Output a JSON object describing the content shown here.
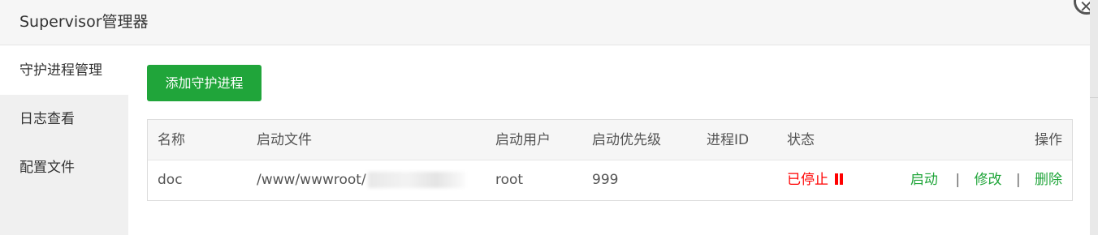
{
  "window": {
    "title": "Supervisor管理器",
    "close_icon": "close-icon"
  },
  "sidebar": {
    "items": [
      {
        "label": "守护进程管理",
        "active": true
      },
      {
        "label": "日志查看",
        "active": false
      },
      {
        "label": "配置文件",
        "active": false
      }
    ]
  },
  "toolbar": {
    "add_label": "添加守护进程"
  },
  "table": {
    "columns": [
      "名称",
      "启动文件",
      "启动用户",
      "启动优先级",
      "进程ID",
      "状态",
      "操作"
    ],
    "rows": [
      {
        "name": "doc",
        "file": "/www/wwwroot/",
        "user": "root",
        "priority": "999",
        "pid": "",
        "status": "已停止",
        "status_icon": "pause-icon",
        "ops": {
          "start": "启动",
          "sep1": "|",
          "edit": "修改",
          "sep2": "|",
          "delete": "删除"
        }
      }
    ]
  },
  "colors": {
    "accent": "#20a53a",
    "danger": "#ff0000",
    "sidebar_bg": "#f0f0f0",
    "header_bg": "#f6f6f6"
  }
}
